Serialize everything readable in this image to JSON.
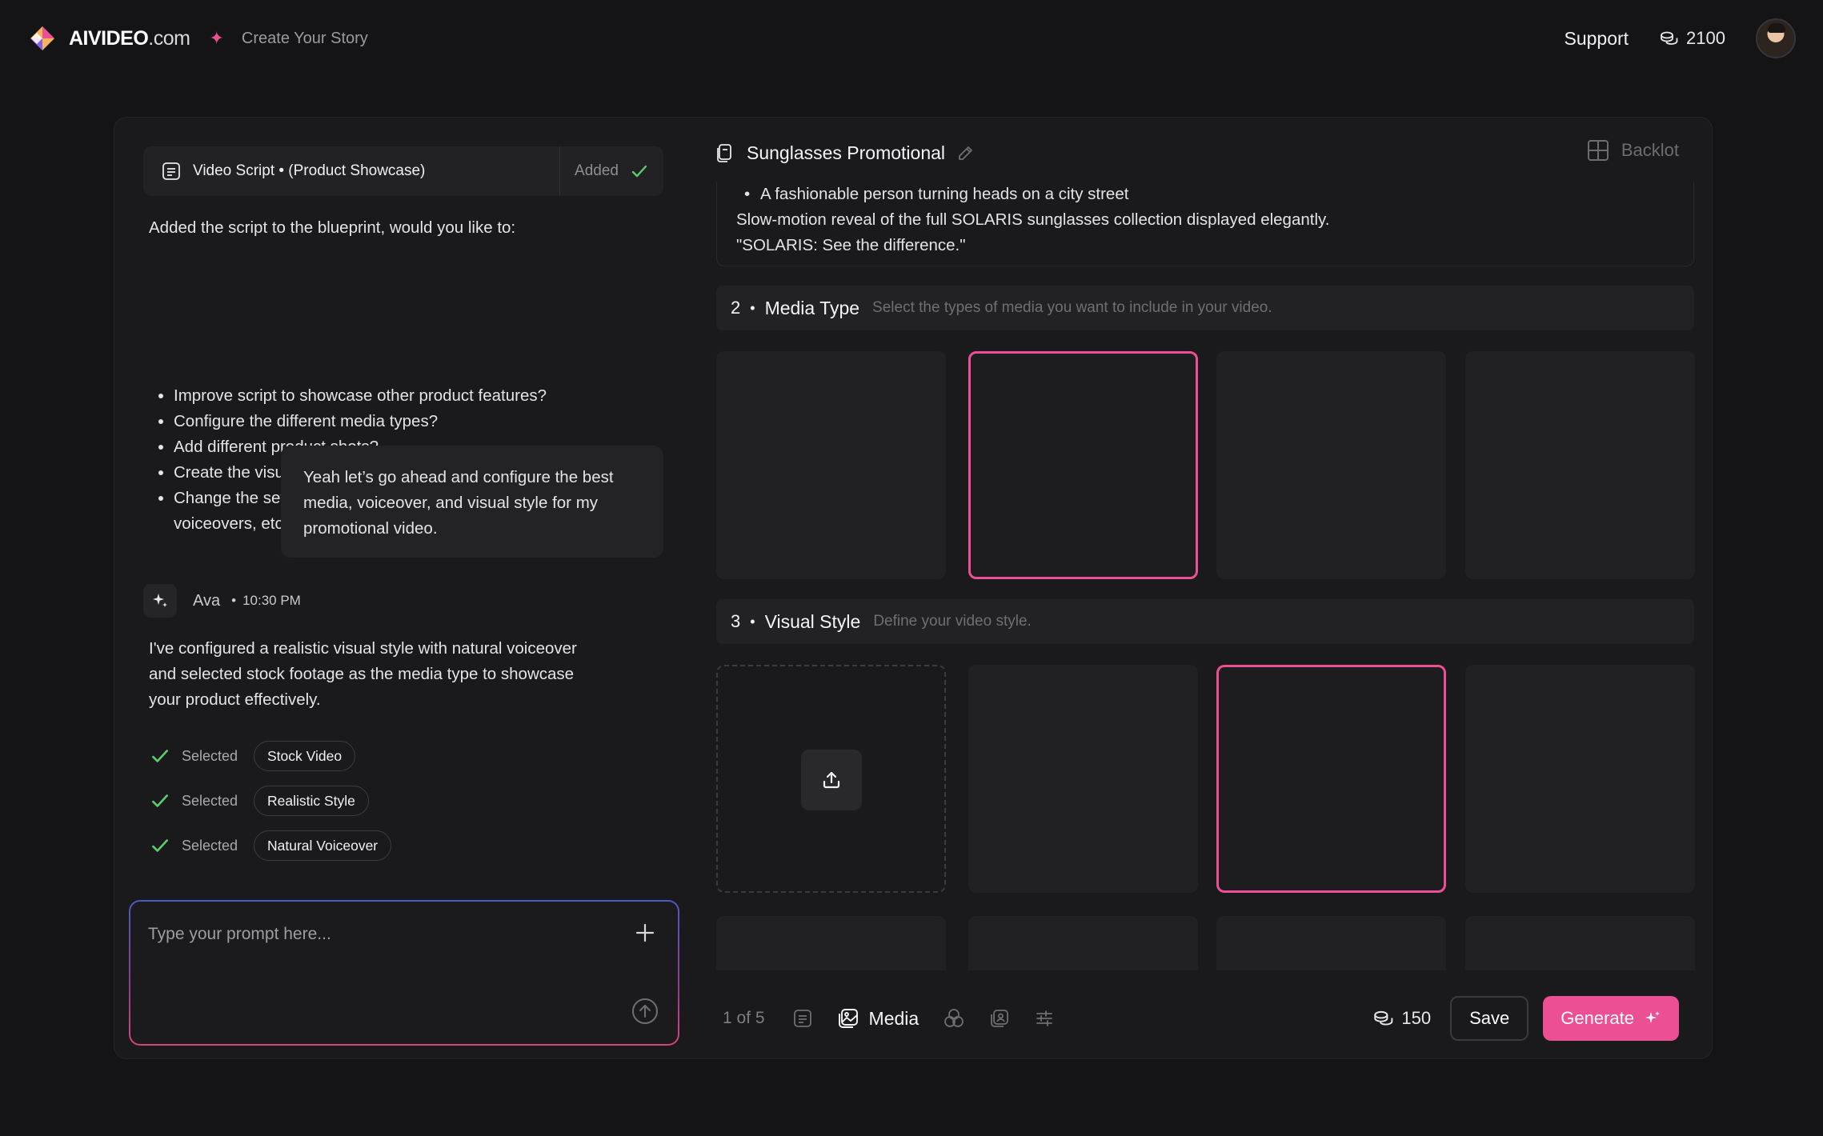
{
  "app": {
    "brand": "AIVIDEO",
    "brand_suffix": ".com",
    "tagline_separator": "✦",
    "tagline": "Create Your Story",
    "support_label": "Support",
    "credits": "2100",
    "accent_color": "#ec4f94"
  },
  "chat": {
    "script_chip": {
      "title": "Video Script • (Product Showcase)",
      "status": "Added"
    },
    "assistant_intro": "Added the script to the blueprint, would you like to:",
    "suggestions": [
      "Improve script to showcase other product features?",
      "Configure the different media types?",
      "Add different product shots?",
      "Create the visual style of the video?",
      "Change the settings of the video? i.e Add captions, music, voiceovers, etc."
    ],
    "user_message": "Yeah let’s go ahead and configure the best media, voiceover, and visual style for my promotional video.",
    "assistant": {
      "name": "Ava",
      "time_separator": "•",
      "time": "10:30 PM",
      "message": "I've configured a realistic visual style with natural voiceover and selected stock footage as the media type to showcase your product effectively."
    },
    "selections": [
      {
        "label": "Selected",
        "value": "Stock Video"
      },
      {
        "label": "Selected",
        "value": "Realistic Style"
      },
      {
        "label": "Selected",
        "value": "Natural Voiceover"
      }
    ],
    "prompt_placeholder": "Type your prompt here..."
  },
  "blueprint": {
    "title": "Sunglasses Promotional",
    "backlot_label": "Backlot",
    "script_lines": {
      "sub_bullet": "A fashionable person turning heads on a city street",
      "line1": "Slow-motion reveal of the full SOLARIS sunglasses collection displayed elegantly.",
      "line2": "\"SOLARIS: See the difference.\""
    },
    "sections": [
      {
        "number": "2",
        "separator": "•",
        "name": "Media Type",
        "description": "Select the types of media you want to include in your video."
      },
      {
        "number": "3",
        "separator": "•",
        "name": "Visual Style",
        "description": "Define your video style."
      }
    ],
    "media_tiles": [
      {
        "id": "media-1",
        "selected": false
      },
      {
        "id": "media-2",
        "selected": true
      },
      {
        "id": "media-3",
        "selected": false
      },
      {
        "id": "media-4",
        "selected": false
      }
    ],
    "style_tiles": [
      {
        "id": "style-upload",
        "selected": false
      },
      {
        "id": "style-1",
        "selected": false
      },
      {
        "id": "style-2",
        "selected": true
      },
      {
        "id": "style-3",
        "selected": false
      }
    ]
  },
  "footer": {
    "pager": "1 of 5",
    "active_tool": "Media",
    "cost": "150",
    "save_label": "Save",
    "generate_label": "Generate"
  }
}
